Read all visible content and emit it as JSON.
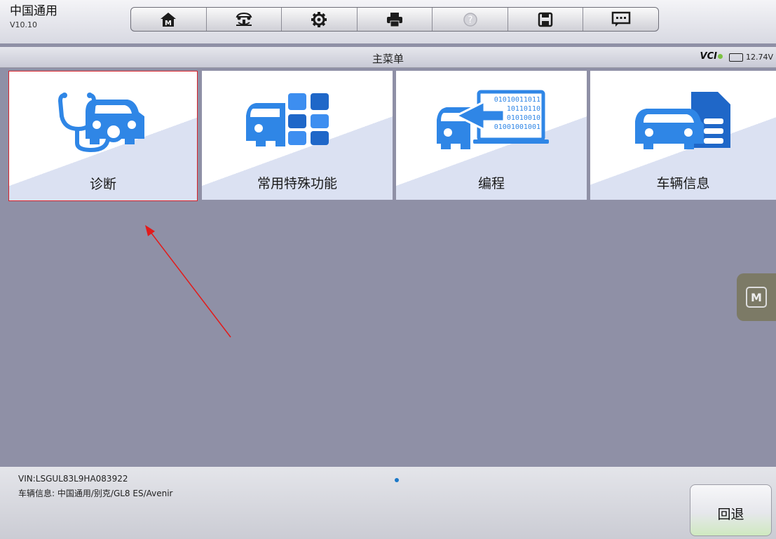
{
  "header": {
    "brand": "中国通用",
    "version": "V10.10",
    "toolbar": [
      {
        "icon": "home-icon"
      },
      {
        "icon": "vehicle-lift-icon"
      },
      {
        "icon": "gear-icon"
      },
      {
        "icon": "printer-icon"
      },
      {
        "icon": "help-icon"
      },
      {
        "icon": "save-icon"
      },
      {
        "icon": "message-icon"
      }
    ]
  },
  "titlebar": {
    "title": "主菜单",
    "vci": "VCI",
    "battery": "12.74V"
  },
  "tiles": [
    {
      "label": "诊断",
      "icon": "diagnosis-car-icon",
      "selected": true
    },
    {
      "label": "常用特殊功能",
      "icon": "special-functions-car-icon"
    },
    {
      "label": "编程",
      "icon": "programming-car-icon",
      "binary": [
        "01010011011",
        "10110110",
        "01010010",
        "01001001001"
      ]
    },
    {
      "label": "车辆信息",
      "icon": "vehicle-info-car-icon"
    }
  ],
  "footer": {
    "vin": "VIN:LSGUL83L9HA083922",
    "vehicle_info": "车辆信息: 中国通用/别克/GL8 ES/Avenir",
    "back_label": "回退"
  },
  "colors": {
    "accent_blue": "#2f86e6",
    "selection_border": "#d9222a",
    "background": "#8f90a6"
  }
}
